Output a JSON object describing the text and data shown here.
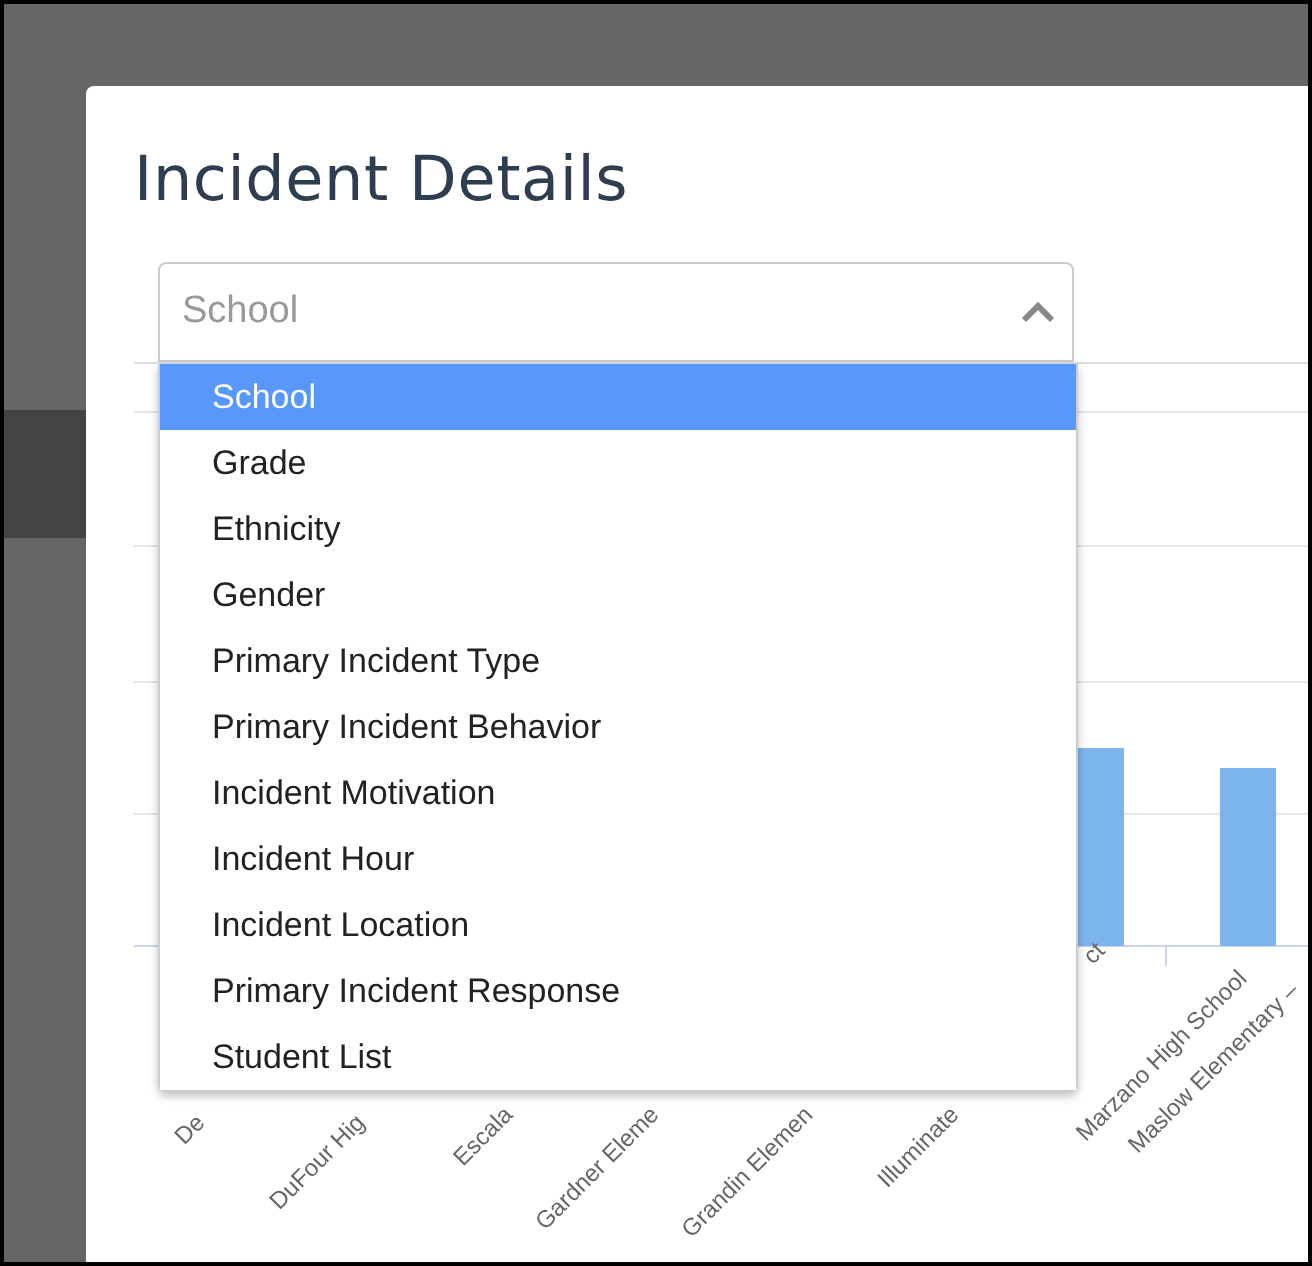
{
  "dialog": {
    "title": "Incident Details"
  },
  "group_by_select": {
    "placeholder": "School",
    "expanded": true,
    "options": [
      {
        "label": "School",
        "selected": true
      },
      {
        "label": "Grade",
        "selected": false
      },
      {
        "label": "Ethnicity",
        "selected": false
      },
      {
        "label": "Gender",
        "selected": false
      },
      {
        "label": "Primary Incident Type",
        "selected": false
      },
      {
        "label": "Primary Incident Behavior",
        "selected": false
      },
      {
        "label": "Incident Motivation",
        "selected": false
      },
      {
        "label": "Incident Hour",
        "selected": false
      },
      {
        "label": "Incident Location",
        "selected": false
      },
      {
        "label": "Primary Incident Response",
        "selected": false
      },
      {
        "label": "Student List",
        "selected": false
      }
    ]
  },
  "chart": {
    "x_labels": [
      "De",
      "DuFour Hig",
      "Escala",
      "Gardner Eleme",
      "Grandin Elemen",
      "Illuminate",
      "ct",
      "Marzano High School",
      "Maslow Elementary –"
    ]
  }
}
